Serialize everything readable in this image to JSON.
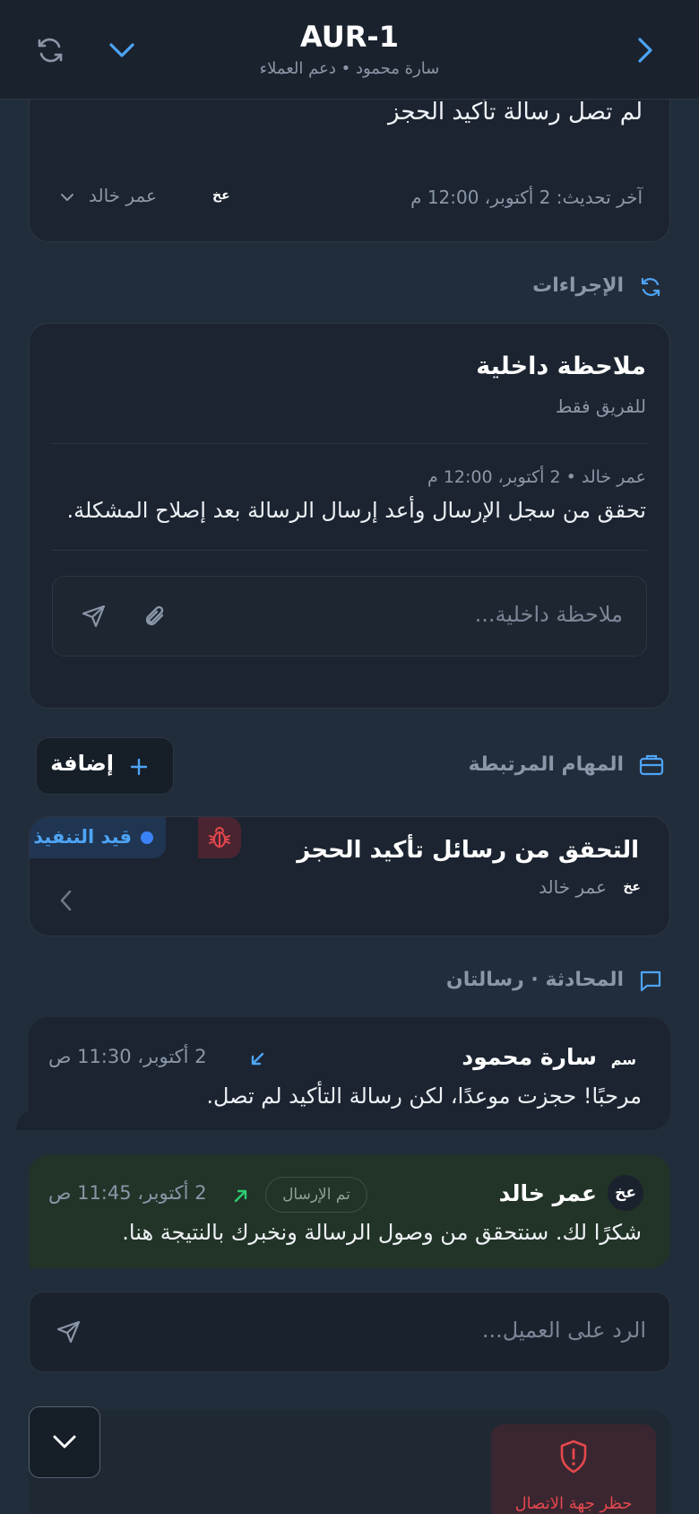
{
  "header": {
    "title": "AUR-1",
    "subtitle": "سارة محمود • دعم العملاء"
  },
  "ticket": {
    "subject": "لم تصل رسالة تأكيد الحجز",
    "updated": "آخر تحديث: 2 أكتوبر، 12:00 م",
    "assignee_initials": "عخ",
    "assignee_name": "عمر خالد"
  },
  "actions": {
    "section_title": "الإجراءات",
    "note_title": "ملاحظة داخلية",
    "note_subtitle": "للفريق فقط",
    "note_meta": "عمر خالد • 2 أكتوبر، 12:00 م",
    "note_text": "تحقق من سجل الإرسال وأعد إرسال الرسالة بعد إصلاح المشكلة.",
    "note_placeholder": "ملاحظة داخلية..."
  },
  "tasks": {
    "section_title": "المهام المرتبطة",
    "add_label": "إضافة",
    "items": [
      {
        "title": "التحقق من رسائل تأكيد الحجز",
        "status": "قيد التنفيذ",
        "assignee_initials": "عخ",
        "assignee_name": "عمر خالد"
      }
    ]
  },
  "conversation": {
    "section_title": "المحادثة · رسالتان",
    "messages": [
      {
        "initials": "سم",
        "author": "سارة محمود",
        "time": "2 أكتوبر، 11:30 ص",
        "text": "مرحبًا! حجزت موعدًا، لكن رسالة التأكيد لم تصل.",
        "direction": "incoming"
      },
      {
        "initials": "عخ",
        "author": "عمر خالد",
        "badge": "تم الإرسال",
        "time": "2 أكتوبر، 11:45 ص",
        "text": "شكرًا لك. سنتحقق من وصول الرسالة ونخبرك بالنتيجة هنا.",
        "direction": "outgoing"
      }
    ],
    "reply_placeholder": "الرد على العميل..."
  },
  "footer": {
    "block_label": "حظر جهة الاتصال"
  },
  "colors": {
    "accent": "#4ea4f5",
    "status_blue": "#3b82f6",
    "danger": "#e5484d",
    "sent_green": "#2ecc71"
  }
}
